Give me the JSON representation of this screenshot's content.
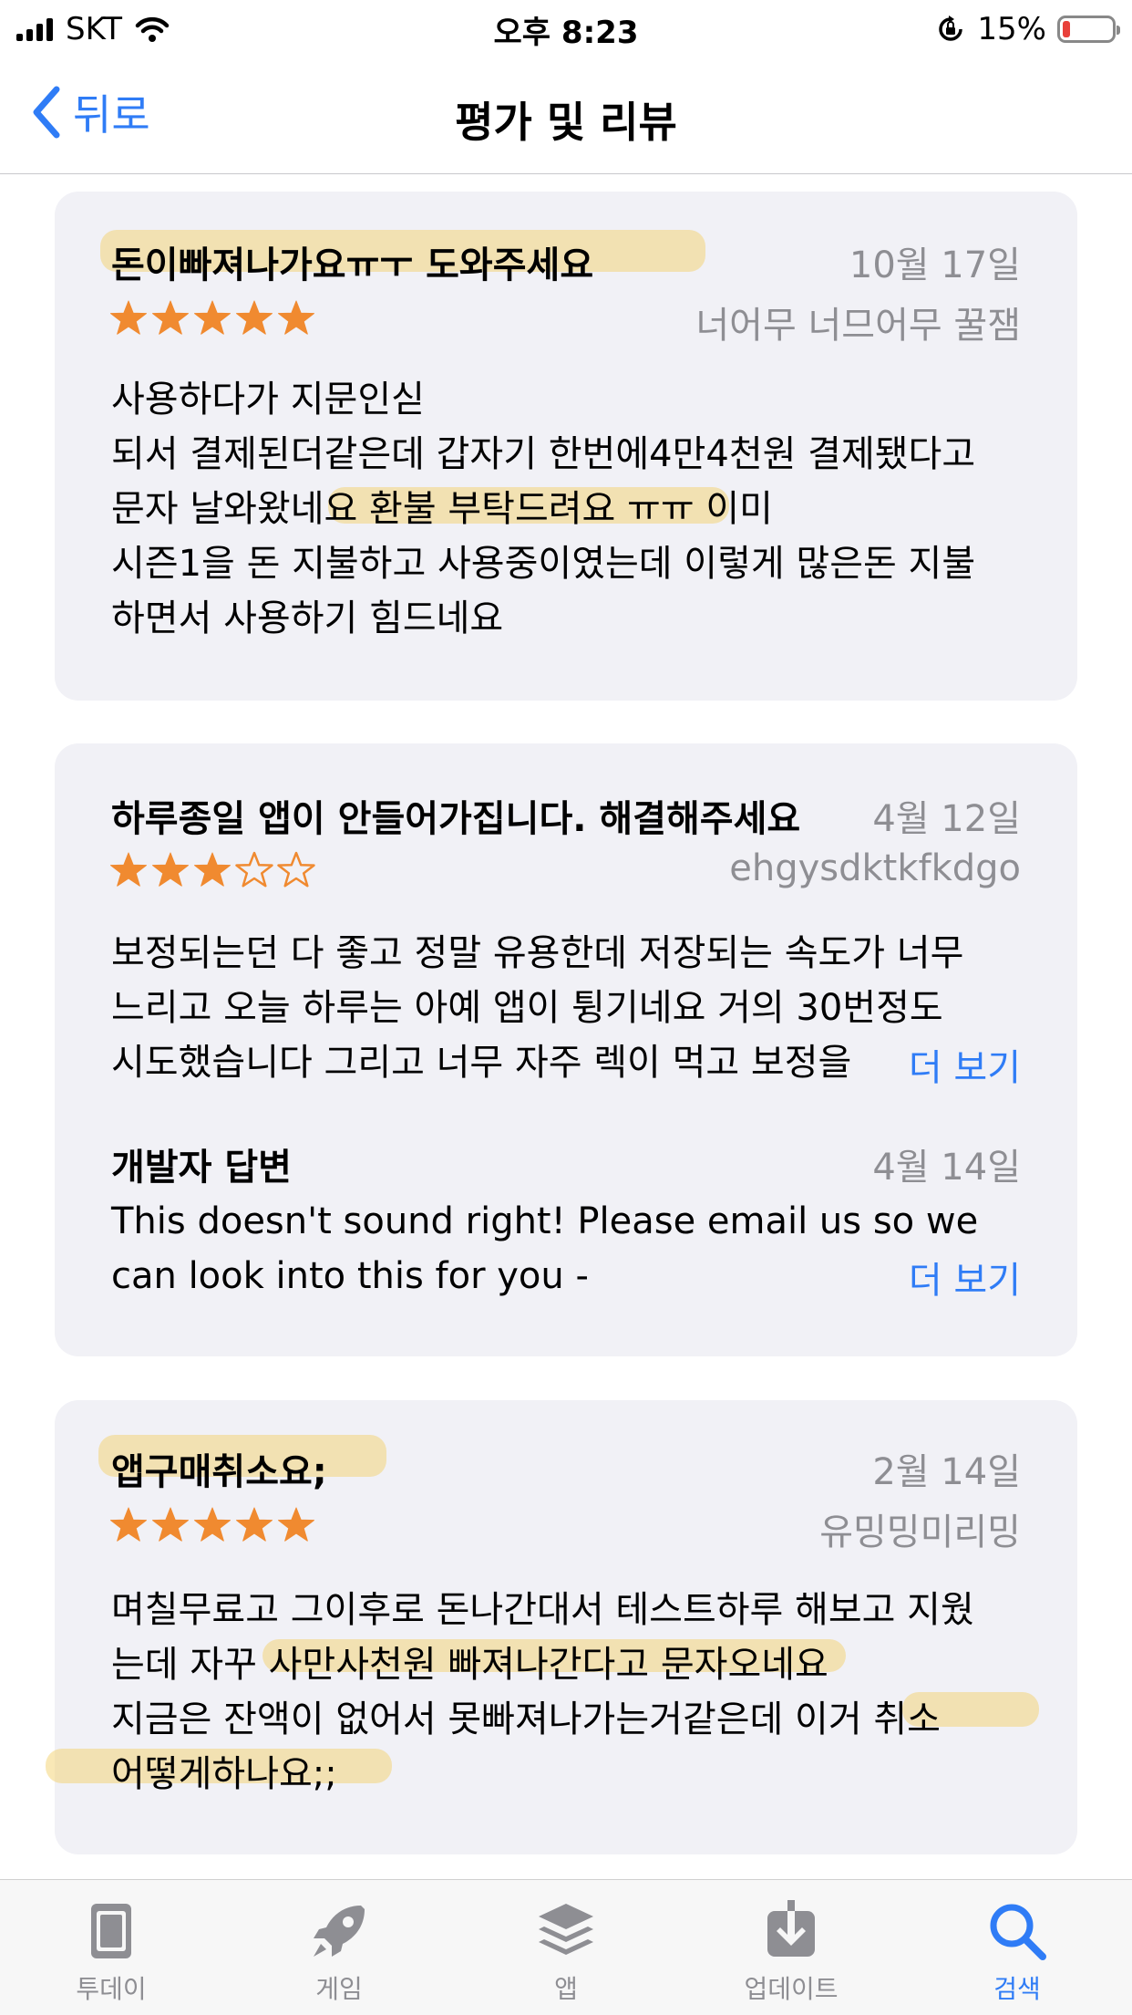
{
  "status_bar": {
    "carrier": "SKT",
    "time": "오후 8:23",
    "battery_percent": "15%",
    "battery_level": 0.15
  },
  "nav": {
    "back_label": "뒤로",
    "title": "평가 및 리뷰"
  },
  "reviews": [
    {
      "title": "돈이빠져나가요ㅠㅜ 도와주세요",
      "date": "10월 17일",
      "author": "너어무 너므어무 꿀잼",
      "rating": 5,
      "body": "사용하다가 지문인싣\n되서 결제된더같은데 갑자기 한번에4만4천원 결제됐다고\n문자 날와왔네요 환불 부탁드려요 ㅠㅠ 이미\n시즌1을 돈 지불하고 사용중이였는데 이렇게 많은돈 지불\n하면서 사용하기 힘드네요"
    },
    {
      "title": "하루종일 앱이 안들어가집니다. 해결해주세요",
      "date": "4월 12일",
      "author": "ehgysdktkfkdgo",
      "rating": 3,
      "body": "보정되는던 다 좋고 정말 유용한데 저장되는 속도가 너무\n느리고 오늘 하루는 아예 앱이 튕기네요 거의 30번정도\n시도했습니다 그리고 너무 자주 렉이 먹고 보정을",
      "more_label": "더 보기",
      "developer_response": {
        "heading": "개발자 답변",
        "date": "4월 14일",
        "body": "This doesn't sound right! Please email us so we\ncan look into this for you -",
        "more_label": "더 보기"
      }
    },
    {
      "title": "앱구매취소요;",
      "date": "2월 14일",
      "author": "유밍밍미리밍",
      "rating": 5,
      "body": "며칠무료고 그이후로 돈나간대서 테스트하루 해보고 지웠\n는데 자꾸 사만사천원 빠져나간다고 문자오네요\n지금은 잔액이 없어서 못빠져나가는거같은데 이거 취소\n어떻게하나요;;"
    }
  ],
  "tab_bar": {
    "items": [
      {
        "label": "투데이",
        "icon": "today-icon"
      },
      {
        "label": "게임",
        "icon": "rocket-icon"
      },
      {
        "label": "앱",
        "icon": "layers-icon"
      },
      {
        "label": "업데이트",
        "icon": "download-icon"
      },
      {
        "label": "검색",
        "icon": "search-icon"
      }
    ],
    "active_index": 4
  },
  "colors": {
    "accent": "#2f7cf6",
    "star": "#f08a30",
    "card_bg": "#f1f1f6",
    "muted_text": "#8e8e93",
    "highlight": "#f4d26e"
  }
}
